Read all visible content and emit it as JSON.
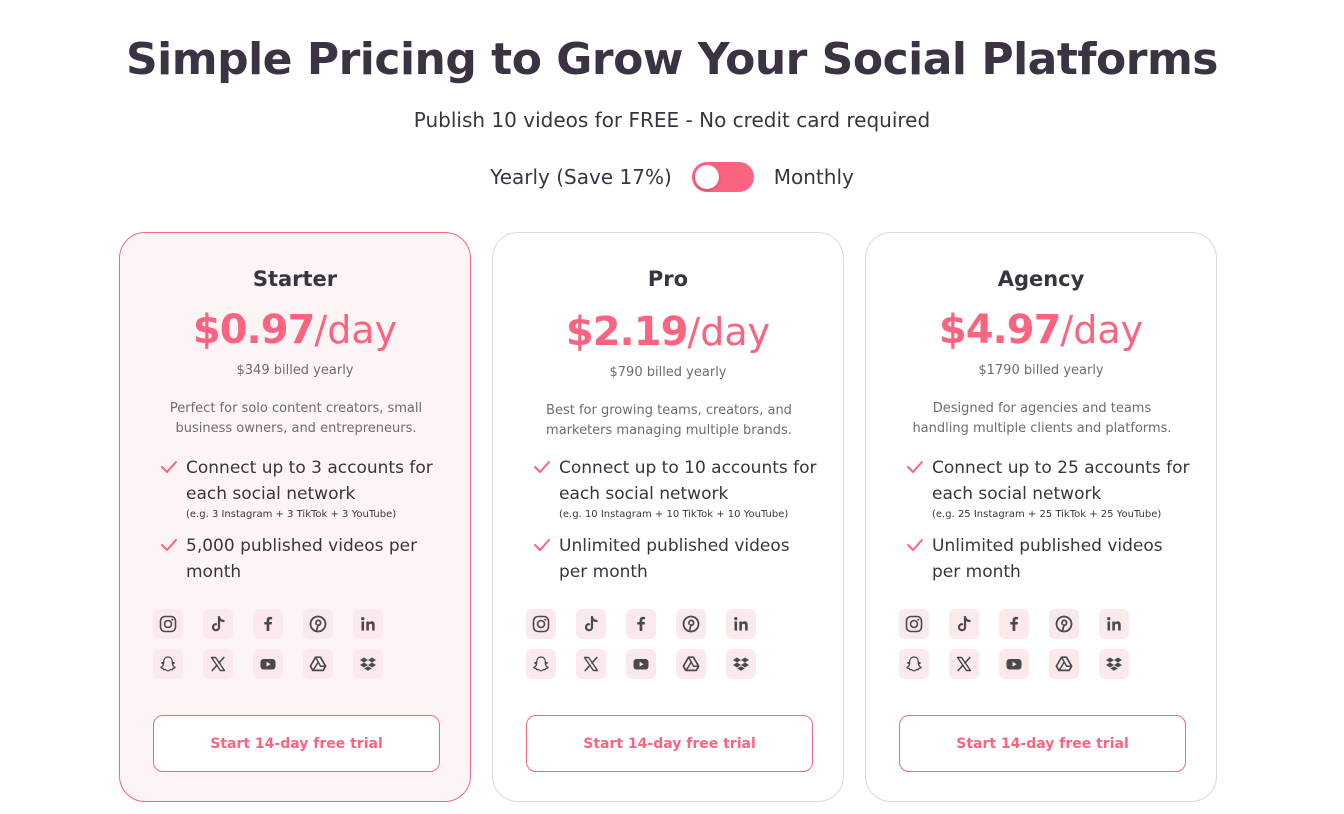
{
  "header": {
    "title": "Simple Pricing to Grow Your Social Platforms",
    "subtitle": "Publish 10 videos for FREE - No credit card required"
  },
  "billing_toggle": {
    "yearly_label": "Yearly (Save 17%)",
    "monthly_label": "Monthly",
    "selected": "Yearly"
  },
  "colors": {
    "accent": "#fb6480",
    "highlight_card_bg": "#fdf4f5",
    "icon_tile_bg": "#fbe9ec",
    "text": "#3a3441"
  },
  "social_icons": [
    "instagram-icon",
    "tiktok-icon",
    "facebook-icon",
    "pinterest-icon",
    "linkedin-icon",
    "snapchat-icon",
    "x-icon",
    "youtube-icon",
    "google-drive-icon",
    "dropbox-icon"
  ],
  "plans": [
    {
      "name": "Starter",
      "price": "$0.97",
      "unit": "/day",
      "billed": "$349 billed yearly",
      "description": "Perfect for solo content creators, small business owners, and entrepreneurs.",
      "features": [
        {
          "text": "Connect up to 3 accounts for each social network",
          "note": "(e.g. 3 Instagram + 3 TikTok + 3 YouTube)"
        },
        {
          "text": "5,000 published videos per month",
          "note": ""
        }
      ],
      "cta": "Start 14-day free trial"
    },
    {
      "name": "Pro",
      "price": "$2.19",
      "unit": "/day",
      "billed": "$790 billed yearly",
      "description": "Best for growing teams, creators, and marketers managing multiple brands.",
      "features": [
        {
          "text": "Connect up to 10 accounts for each social network",
          "note": "(e.g. 10 Instagram + 10 TikTok + 10 YouTube)"
        },
        {
          "text": "Unlimited published videos per month",
          "note": ""
        }
      ],
      "cta": "Start 14-day free trial"
    },
    {
      "name": "Agency",
      "price": "$4.97",
      "unit": "/day",
      "billed": "$1790 billed yearly",
      "description": "Designed for agencies and teams handling multiple clients and platforms.",
      "features": [
        {
          "text": "Connect up to 25 accounts for each social network",
          "note": "(e.g. 25 Instagram + 25 TikTok + 25 YouTube)"
        },
        {
          "text": "Unlimited published videos per month",
          "note": ""
        }
      ],
      "cta": "Start 14-day free trial"
    }
  ]
}
